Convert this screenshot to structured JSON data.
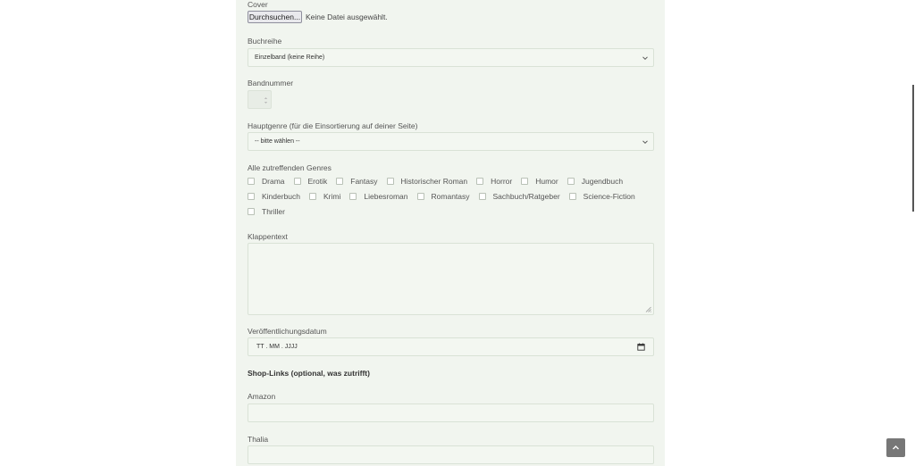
{
  "form": {
    "cover": {
      "label": "Cover",
      "button": "Durchsuchen...",
      "status": "Keine Datei ausgewählt."
    },
    "series": {
      "label": "Buchreihe",
      "value": "Einzelband (keine Reihe)"
    },
    "volume": {
      "label": "Bandnummer"
    },
    "main_genre": {
      "label": "Hauptgenre (für die Einsortierung auf deiner Seite)",
      "value": "-- bitte wählen --"
    },
    "genres": {
      "label": "Alle zutreffenden Genres",
      "items": [
        "Drama",
        "Erotik",
        "Fantasy",
        "Historischer Roman",
        "Horror",
        "Humor",
        "Jugendbuch",
        "Kinderbuch",
        "Krimi",
        "Liebesroman",
        "Romantasy",
        "Sachbuch/Ratgeber",
        "Science-Fiction",
        "Thriller"
      ]
    },
    "blurb": {
      "label": "Klappentext"
    },
    "release_date": {
      "label": "Veröffentlichungsdatum",
      "placeholder": "TT . MM . JJJJ"
    },
    "shop_links": {
      "heading": "Shop-Links (optional, was zutrifft)"
    },
    "amazon": {
      "label": "Amazon"
    },
    "thalia": {
      "label": "Thalia"
    }
  },
  "icons": {
    "select_arrow": "chevron-down-icon",
    "calendar": "calendar-icon",
    "back_to_top": "chevron-up-icon"
  },
  "colors": {
    "panel_bg": "#f1f5ef",
    "field_bg": "#f3f7f1",
    "field_border": "#d9e2d6",
    "top_button": "#777777"
  }
}
